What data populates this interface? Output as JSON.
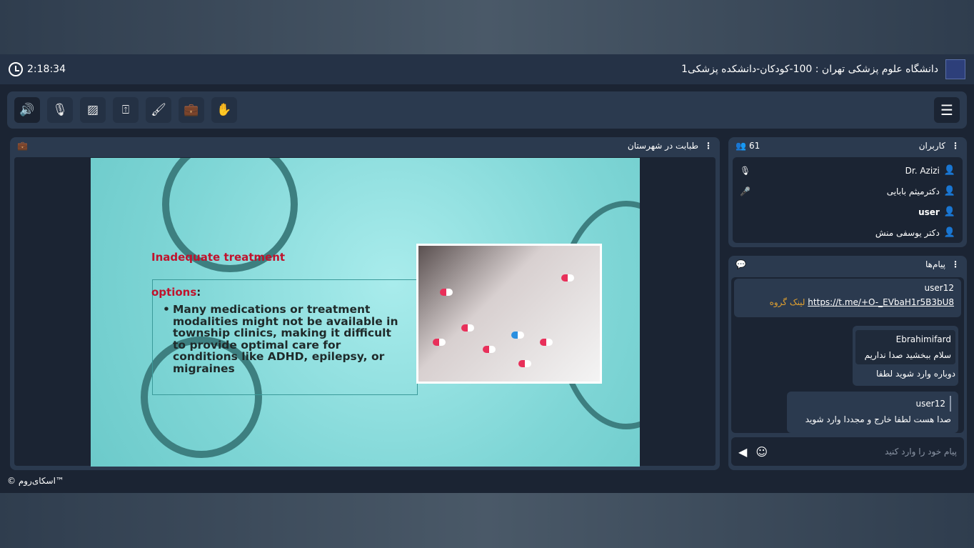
{
  "header": {
    "timer": "2:18:34",
    "title": "دانشگاه علوم پزشکی تهران : 100-کودکان-دانشکده پزشکی1"
  },
  "toolbar": {
    "buttons": [
      "speaker",
      "mic-off",
      "video-off",
      "share-screen",
      "brush",
      "briefcase",
      "raise-hand"
    ]
  },
  "stage": {
    "title": "طبابت در شهرستان"
  },
  "slide": {
    "title": "Inadequate treatment",
    "subtitle": "options",
    "colon": ":",
    "bullet": "Many medications or treatment modalities might not be available in township clinics, making it difficult to provide optimal care for conditions like ADHD, epilepsy, or migraines"
  },
  "users": {
    "title": "کاربران",
    "count": "61",
    "list": [
      {
        "name": "Dr. Azizi",
        "mic": "on-gray"
      },
      {
        "name": "دکترمیثم بابایی",
        "mic": "on-blue"
      },
      {
        "name": "user",
        "mic": ""
      },
      {
        "name": "دکتر یوسفی منش",
        "mic": ""
      }
    ]
  },
  "chat": {
    "title": "پیام‌ها",
    "messages": [
      {
        "sender": "user12",
        "link": "https://t.me/+O-_EVbaH1r5B3bU8",
        "link_label": "لینک گروه"
      },
      {
        "quote_sender": "Ebrahimifard",
        "quote_text": "سلام ببخشید صدا نداریم",
        "text": "دوباره وارد شوید لطفا"
      },
      {
        "sender": "user12",
        "text": "صدا هست لطفا خارج و مجددا وارد شوید"
      }
    ],
    "placeholder": "پیام خود را وارد کنید"
  },
  "footer": {
    "brand": "© اسکای‌روم™"
  }
}
